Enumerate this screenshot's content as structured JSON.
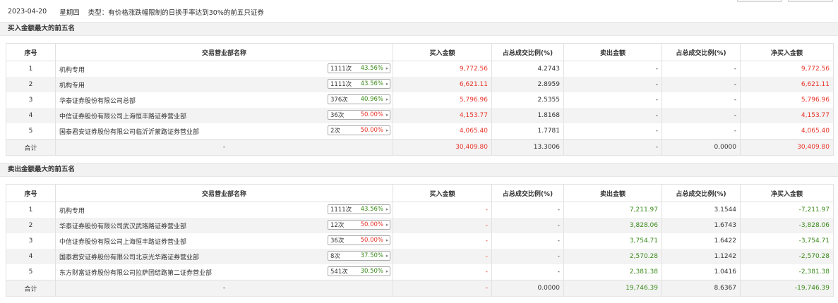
{
  "header": {
    "date": "2023-04-20",
    "weekday": "星期四",
    "type_text": "类型：有价格涨跌幅限制的日换手率达到30%的前五只证券"
  },
  "columns": [
    "序号",
    "交易营业部名称",
    "买入金额",
    "占总成交比例(%)",
    "卖出金额",
    "占总成交比例(%)",
    "净买入金额"
  ],
  "buy_section": {
    "title": "买入金额最大的前五名",
    "rows": [
      {
        "idx": "1",
        "name": "机构专用",
        "count": "1111次",
        "pct": "43.56%",
        "pct_color": "green",
        "buy": "9,772.56",
        "buy_ratio": "4.2743",
        "sell": "-",
        "sell_ratio": "-",
        "net": "9,772.56"
      },
      {
        "idx": "2",
        "name": "机构专用",
        "count": "1111次",
        "pct": "43.56%",
        "pct_color": "green",
        "buy": "6,621.11",
        "buy_ratio": "2.8959",
        "sell": "-",
        "sell_ratio": "-",
        "net": "6,621.11"
      },
      {
        "idx": "3",
        "name": "华泰证券股份有限公司总部",
        "count": "376次",
        "pct": "40.96%",
        "pct_color": "green",
        "buy": "5,796.96",
        "buy_ratio": "2.5355",
        "sell": "-",
        "sell_ratio": "-",
        "net": "5,796.96"
      },
      {
        "idx": "4",
        "name": "中信证券股份有限公司上海恒丰路证券营业部",
        "count": "36次",
        "pct": "50.00%",
        "pct_color": "red",
        "buy": "4,153.77",
        "buy_ratio": "1.8168",
        "sell": "-",
        "sell_ratio": "-",
        "net": "4,153.77"
      },
      {
        "idx": "5",
        "name": "国泰君安证券股份有限公司临沂沂蒙路证券营业部",
        "count": "2次",
        "pct": "50.00%",
        "pct_color": "red",
        "buy": "4,065.40",
        "buy_ratio": "1.7781",
        "sell": "-",
        "sell_ratio": "-",
        "net": "4,065.40"
      }
    ],
    "total": {
      "label": "合计",
      "name": "-",
      "buy": "30,409.80",
      "buy_ratio": "13.3006",
      "sell": "-",
      "sell_ratio": "0.0000",
      "net": "30,409.80"
    }
  },
  "sell_section": {
    "title": "卖出金额最大的前五名",
    "rows": [
      {
        "idx": "1",
        "name": "机构专用",
        "count": "1111次",
        "pct": "43.56%",
        "pct_color": "green",
        "buy": "-",
        "buy_ratio": "-",
        "sell": "7,211.97",
        "sell_ratio": "3.1544",
        "net": "-7,211.97"
      },
      {
        "idx": "2",
        "name": "华泰证券股份有限公司武汉武珞路证券营业部",
        "count": "12次",
        "pct": "50.00%",
        "pct_color": "red",
        "buy": "-",
        "buy_ratio": "-",
        "sell": "3,828.06",
        "sell_ratio": "1.6743",
        "net": "-3,828.06"
      },
      {
        "idx": "3",
        "name": "中信证券股份有限公司上海恒丰路证券营业部",
        "count": "36次",
        "pct": "50.00%",
        "pct_color": "red",
        "buy": "-",
        "buy_ratio": "-",
        "sell": "3,754.71",
        "sell_ratio": "1.6422",
        "net": "-3,754.71"
      },
      {
        "idx": "4",
        "name": "国泰君安证券股份有限公司北京光华路证券营业部",
        "count": "8次",
        "pct": "37.50%",
        "pct_color": "green",
        "buy": "-",
        "buy_ratio": "-",
        "sell": "2,570.28",
        "sell_ratio": "1.1242",
        "net": "-2,570.28"
      },
      {
        "idx": "5",
        "name": "东方财富证券股份有限公司拉萨团结路第二证券营业部",
        "count": "541次",
        "pct": "30.50%",
        "pct_color": "green",
        "buy": "-",
        "buy_ratio": "-",
        "sell": "2,381.38",
        "sell_ratio": "1.0416",
        "net": "-2,381.38"
      }
    ],
    "total": {
      "label": "合计",
      "name": "-",
      "buy": "-",
      "buy_ratio": "0.0000",
      "sell": "19,746.39",
      "sell_ratio": "8.6367",
      "net": "-19,746.39"
    }
  },
  "colors": {
    "red": "#e8342a",
    "green": "#3a8a1a"
  }
}
